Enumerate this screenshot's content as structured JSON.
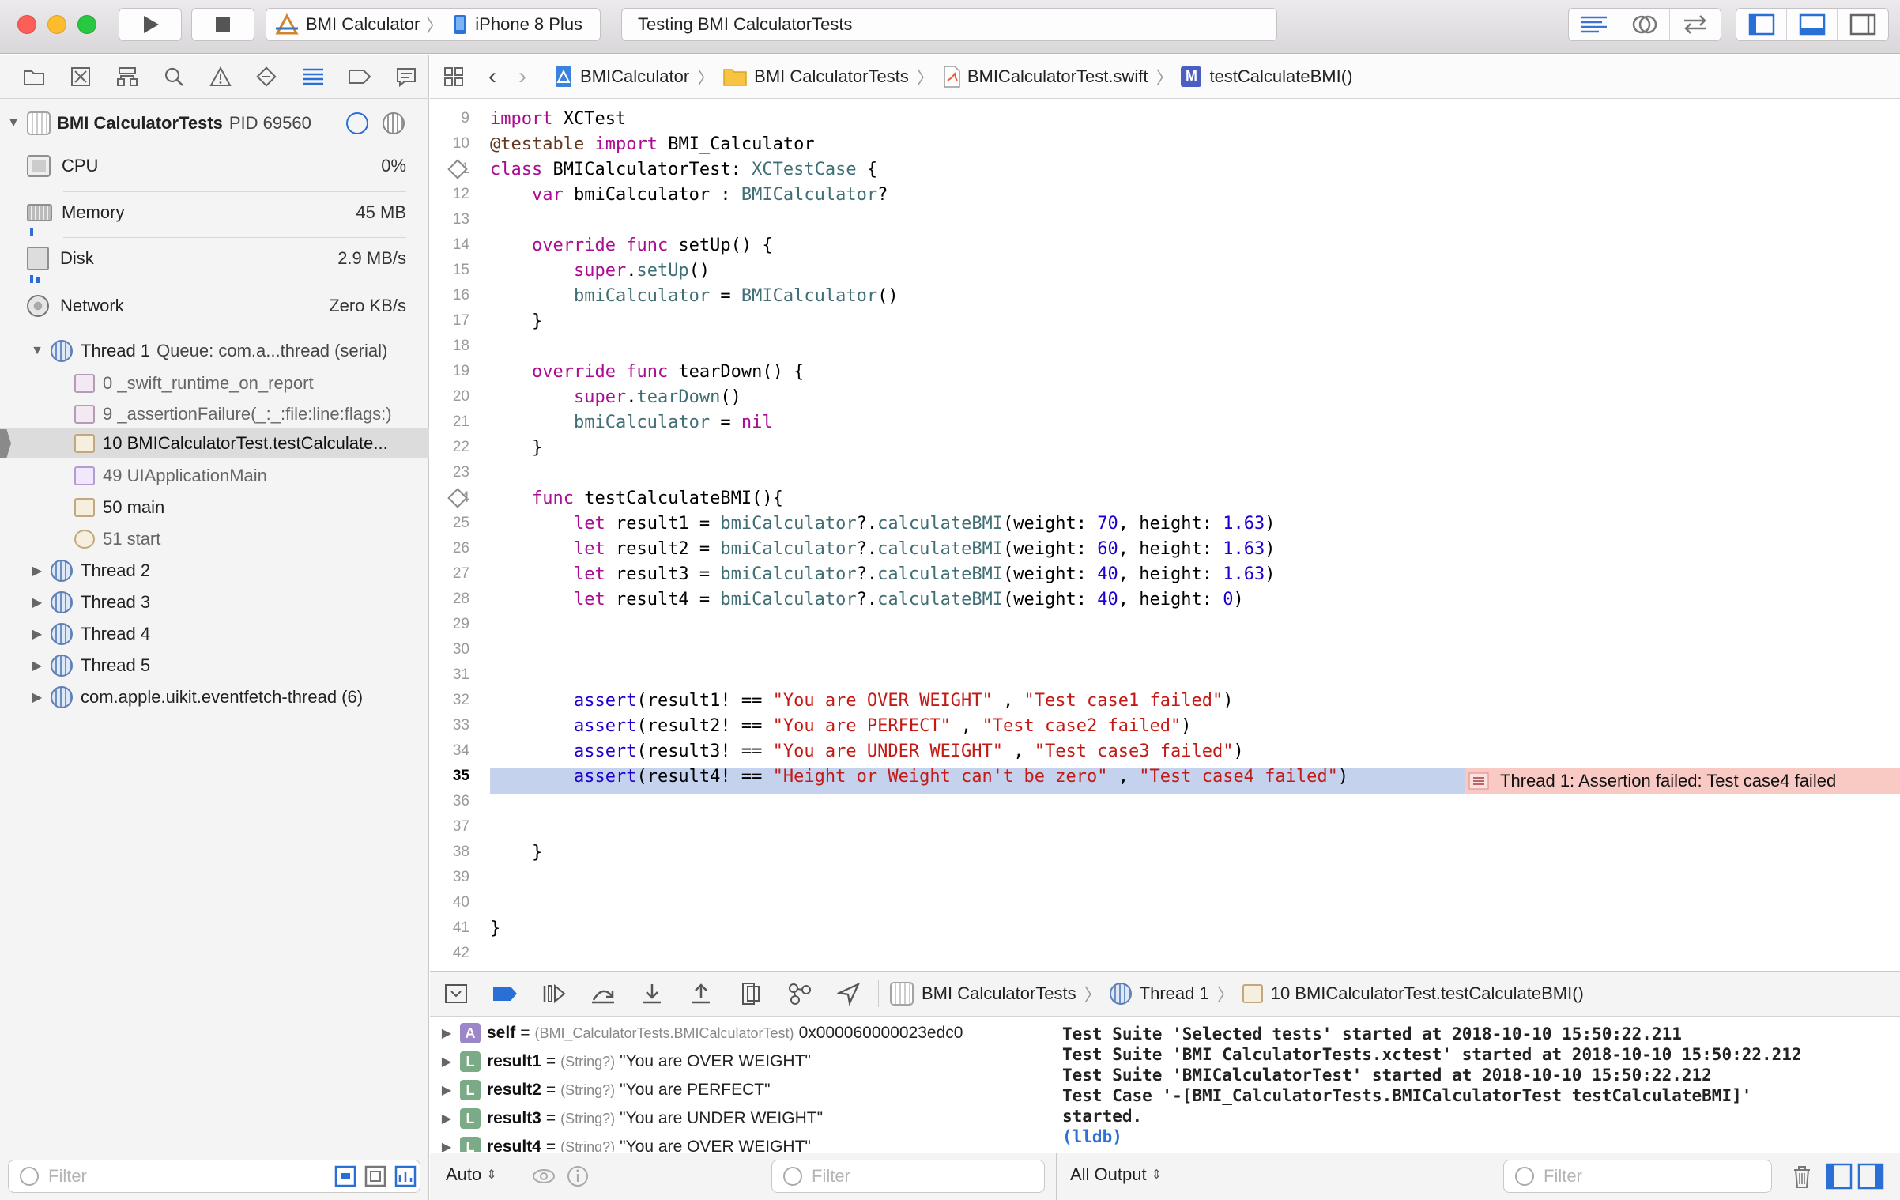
{
  "toolbar": {
    "scheme_target": "BMI Calculator",
    "scheme_device": "iPhone 8 Plus",
    "activity_text": "Testing BMI CalculatorTests"
  },
  "navigator": {
    "process": {
      "name": "BMI CalculatorTests",
      "pid": "PID 69560"
    },
    "gauges": [
      {
        "label": "CPU",
        "value": "0%"
      },
      {
        "label": "Memory",
        "value": "45 MB"
      },
      {
        "label": "Disk",
        "value": "2.9 MB/s"
      },
      {
        "label": "Network",
        "value": "Zero KB/s"
      }
    ],
    "thread1": {
      "name": "Thread 1",
      "queue": "Queue: com.a...thread (serial)"
    },
    "frames": [
      "0 _swift_runtime_on_report",
      "9 _assertionFailure(_:_:file:line:flags:)",
      "10 BMICalculatorTest.testCalculate...",
      "49 UIApplicationMain",
      "50 main",
      "51 start"
    ],
    "threads": [
      "Thread 2",
      "Thread 3",
      "Thread 4",
      "Thread 5",
      "com.apple.uikit.eventfetch-thread (6)"
    ],
    "filter_placeholder": "Filter"
  },
  "jumpbar": {
    "crumbs": [
      "BMICalculator",
      "BMI CalculatorTests",
      "BMICalculatorTest.swift",
      "testCalculateBMI()"
    ]
  },
  "editor": {
    "line_numbers": [
      "9",
      "10",
      "11",
      "12",
      "13",
      "14",
      "15",
      "16",
      "17",
      "18",
      "19",
      "20",
      "21",
      "22",
      "23",
      "24",
      "25",
      "26",
      "27",
      "28",
      "29",
      "30",
      "31",
      "32",
      "33",
      "34",
      "35",
      "36",
      "37",
      "38",
      "39",
      "40",
      "41",
      "42"
    ],
    "error_message": "Thread 1: Assertion failed: Test case4 failed"
  },
  "debugbar": {
    "crumbs": [
      "BMI CalculatorTests",
      "Thread 1",
      "10 BMICalculatorTest.testCalculateBMI()"
    ]
  },
  "variables": [
    {
      "badge": "A",
      "name": "self",
      "type": "(BMI_CalculatorTests.BMICalculatorTest)",
      "value": "0x000060000023edc0"
    },
    {
      "badge": "L",
      "name": "result1",
      "type": "(String?)",
      "value": "\"You are OVER WEIGHT\""
    },
    {
      "badge": "L",
      "name": "result2",
      "type": "(String?)",
      "value": "\"You are PERFECT\""
    },
    {
      "badge": "L",
      "name": "result3",
      "type": "(String?)",
      "value": "\"You are UNDER WEIGHT\""
    },
    {
      "badge": "L",
      "name": "result4",
      "type": "(String?)",
      "value": "\"You are OVER WEIGHT\""
    }
  ],
  "console": {
    "lines": [
      "Test Suite 'Selected tests' started at 2018-10-10 15:50:22.211",
      "Test Suite 'BMI CalculatorTests.xctest' started at 2018-10-10 15:50:22.212",
      "Test Suite 'BMICalculatorTest' started at 2018-10-10 15:50:22.212",
      "Test Case '-[BMI_CalculatorTests.BMICalculatorTest testCalculateBMI]'",
      "started."
    ],
    "prompt": "(lldb)"
  },
  "bottombar": {
    "auto_label": "Auto",
    "output_label": "All Output",
    "filter_placeholder": "Filter"
  },
  "colors": {
    "highlight_line": "#c4d2ee",
    "error_band": "#f9c9c4",
    "accent": "#2f6fd6"
  }
}
